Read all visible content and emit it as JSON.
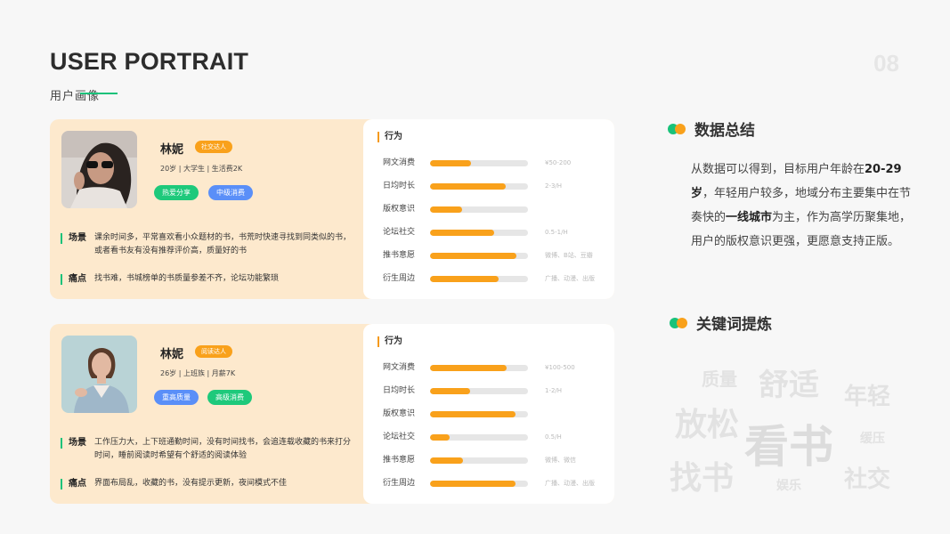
{
  "header": {
    "title": "USER PORTRAIT",
    "subtitle": "用户画像",
    "page_number": "08"
  },
  "personas": [
    {
      "name": "林妮",
      "tag": "社交达人",
      "meta": "20岁 | 大学生 | 生活费2K",
      "pills": [
        "热爱分享",
        "中级消费"
      ],
      "scene_label": "场景",
      "scene_text": "课余时间多，平常喜欢看小众题材的书，书荒时快速寻找到同类似的书，或者看书友有没有推荐评价高，质量好的书",
      "pain_label": "痛点",
      "pain_text": "找书难，书城榜单的书质量参差不齐，论坛功能繁琐",
      "behavior_title": "行为",
      "metrics": [
        {
          "label": "网文消费",
          "value": 0.42,
          "note": "¥50-200"
        },
        {
          "label": "日均时长",
          "value": 0.77,
          "note": "2-3/H"
        },
        {
          "label": "版权意识",
          "value": 0.33,
          "note": ""
        },
        {
          "label": "论坛社交",
          "value": 0.65,
          "note": "0.5-1/H"
        },
        {
          "label": "推书意愿",
          "value": 0.88,
          "note": "微博、B站、豆瓣"
        },
        {
          "label": "衍生周边",
          "value": 0.7,
          "note": "广播、动漫、出版"
        }
      ]
    },
    {
      "name": "林妮",
      "tag": "阅读达人",
      "meta": "26岁 | 上班族 | 月薪7K",
      "pills": [
        "重高质量",
        "高级消费"
      ],
      "scene_label": "场景",
      "scene_text": "工作压力大，上下班通勤时间，没有时间找书，会追连载收藏的书来打分时间，睡前阅读时希望有个舒适的阅读体验",
      "pain_label": "痛点",
      "pain_text": "界面布局乱，收藏的书，没有提示更新，夜间模式不佳",
      "behavior_title": "行为",
      "metrics": [
        {
          "label": "网文消费",
          "value": 0.78,
          "note": "¥100-500"
        },
        {
          "label": "日均时长",
          "value": 0.41,
          "note": "1-2/H"
        },
        {
          "label": "版权意识",
          "value": 0.87,
          "note": ""
        },
        {
          "label": "论坛社交",
          "value": 0.2,
          "note": "0.5/H"
        },
        {
          "label": "推书意愿",
          "value": 0.34,
          "note": "微博、微信"
        },
        {
          "label": "衍生周边",
          "value": 0.87,
          "note": "广播、动漫、出版"
        }
      ]
    }
  ],
  "summary": {
    "heading": "数据总结",
    "parts": [
      {
        "text": "从数据可以得到，目标用户年龄在",
        "bold": false
      },
      {
        "text": "20-29岁",
        "bold": true
      },
      {
        "text": "，年轻用户较多，地域分布主要集中在节奏快的",
        "bold": false
      },
      {
        "text": "一线城市",
        "bold": true
      },
      {
        "text": "为主，作为高学历聚集地，用户的版权意识更强，更愿意支持正版。",
        "bold": false
      }
    ]
  },
  "keywords": {
    "heading": "关键词提炼",
    "words": [
      "质量",
      "舒适",
      "年轻",
      "放松",
      "看书",
      "缓压",
      "找书",
      "娱乐",
      "社交"
    ]
  },
  "colors": {
    "accent_green": "#19c27a",
    "accent_orange": "#f9a11b",
    "pill_blue": "#5a8ff8",
    "card_bg": "#fde9cd"
  }
}
